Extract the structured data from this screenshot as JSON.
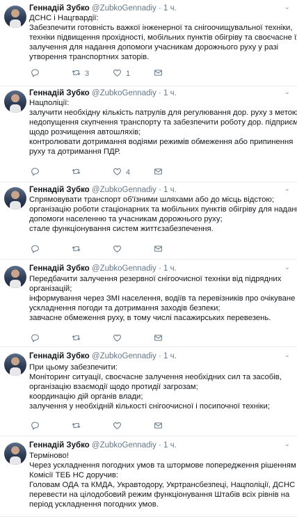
{
  "author": {
    "name": "Геннадій Зубко",
    "handle": "@ZubkoGennadiy",
    "separator": "·",
    "time": "1 ч."
  },
  "tweets": [
    {
      "lines": [
        "ДСНС і Нацгвардії:",
        "Забезпечити готовність важкої інженерної та снігоочищувальної техніки,",
        "техніки підвищення прохідності, мобільних пунктів обігріву та своєчасне їх",
        "залучення для надання допомоги учасникам дорожнього руху у разі",
        "утворення транспортних заторів."
      ],
      "replies": "",
      "retweets": "3",
      "likes": "1"
    },
    {
      "lines": [
        "Нацполіції:",
        "залучити необхідну кількість патрулів для регулювання дор. руху з метою",
        "недопущення скупчення транспорту та забезпечити роботу дор. підприємств",
        "щодо розчищення автошляхів;",
        "контролювати дотримання водіями режимів обмеження або припинення",
        "руху та дотримання ПДР."
      ],
      "replies": "",
      "retweets": "",
      "likes": "4"
    },
    {
      "lines": [
        "Спрямовувати транспорт об'їзними шляхами або до місць відстою;",
        "організацію роботи стаціонарних та мобільних пунктів обігріву для надання",
        "допомоги населенню та учасникам дорожнього руху;",
        "стале функціонування систем життєзабезпечення."
      ],
      "replies": "",
      "retweets": "",
      "likes": ""
    },
    {
      "lines": [
        "Передбачити залучення резервної снігоочисної техніки від підрядних",
        "організацій;",
        "інформування через ЗМІ населення, водіїв та перевізників про очікуване",
        "ускладнення погоди та дотримання заходів безпеки;",
        "завчасне обмеження руху, в тому числі пасажирських перевезень."
      ],
      "replies": "",
      "retweets": "",
      "likes": ""
    },
    {
      "lines": [
        "При цьому забезпечити:",
        "Моніторинг ситуації, своєчасне залучення необхідних сил та засобів,",
        "організацію взаємодії щодо протидії загрозам;",
        "координацію дій органів влади;",
        "залучення у необхідній кількості снігоочисної і посипочної техніки;"
      ],
      "replies": "",
      "retweets": "",
      "likes": ""
    },
    {
      "lines": [
        "Терміново!",
        "Через ускладнення погодних умов та штормове попередження рішенням",
        "Комісії ТЕБ НС доручив:",
        "Головам ОДА та КМДА, Укравтодору, Укртрансбезпеці, Нацполіції, ДСНС",
        "перевести на цілодобовий режим функціонування Штабів всіх рівнів на",
        "період ускладнення погодних умов."
      ],
      "replies": "",
      "retweets": "",
      "likes": ""
    }
  ],
  "icons": {
    "reply": "reply-icon",
    "retweet": "retweet-icon",
    "like": "heart-icon",
    "dm": "envelope-icon",
    "more": "chevron-down-icon"
  },
  "colors": {
    "text": "#14171a",
    "secondary": "#657786",
    "divider": "#e6ecf0"
  }
}
